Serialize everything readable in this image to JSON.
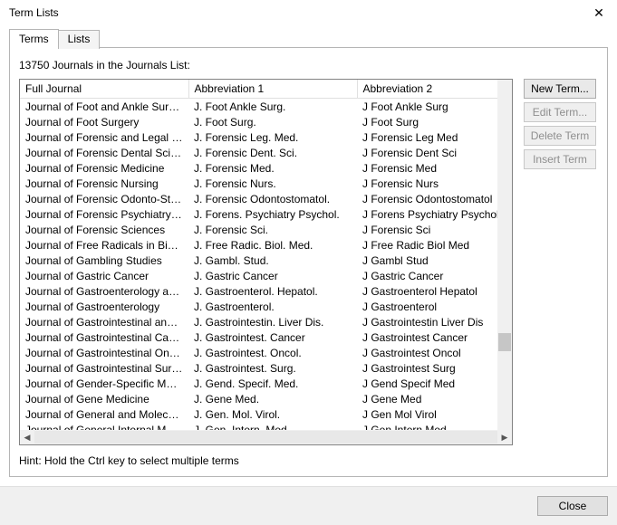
{
  "window": {
    "title": "Term Lists",
    "close_label": "✕"
  },
  "tabs": {
    "terms": "Terms",
    "lists": "Lists"
  },
  "count_text": "13750 Journals in the Journals List:",
  "columns": {
    "full": "Full Journal",
    "a1": "Abbreviation 1",
    "a2": "Abbreviation 2"
  },
  "rows": [
    {
      "full": "Journal of Foot and Ankle Surgery",
      "a1": "J. Foot Ankle Surg.",
      "a2": "J Foot Ankle Surg"
    },
    {
      "full": "Journal of Foot Surgery",
      "a1": "J. Foot Surg.",
      "a2": "J Foot Surg"
    },
    {
      "full": "Journal of Forensic and Legal Me...",
      "a1": "J. Forensic Leg. Med.",
      "a2": "J Forensic Leg Med"
    },
    {
      "full": "Journal of Forensic Dental Sciences",
      "a1": "J. Forensic Dent. Sci.",
      "a2": "J Forensic Dent Sci"
    },
    {
      "full": "Journal of Forensic Medicine",
      "a1": "J. Forensic Med.",
      "a2": "J Forensic Med"
    },
    {
      "full": "Journal of Forensic Nursing",
      "a1": "J. Forensic Nurs.",
      "a2": "J Forensic Nurs"
    },
    {
      "full": "Journal of Forensic Odonto-Stom...",
      "a1": "J. Forensic Odontostomatol.",
      "a2": "J Forensic Odontostomatol"
    },
    {
      "full": "Journal of Forensic Psychiatry & ...",
      "a1": "J. Forens. Psychiatry Psychol.",
      "a2": "J Forens Psychiatry Psychol"
    },
    {
      "full": "Journal of Forensic Sciences",
      "a1": "J. Forensic Sci.",
      "a2": "J Forensic Sci"
    },
    {
      "full": "Journal of Free Radicals in Biolog...",
      "a1": "J. Free Radic. Biol. Med.",
      "a2": "J Free Radic Biol Med"
    },
    {
      "full": "Journal of Gambling Studies",
      "a1": "J. Gambl. Stud.",
      "a2": "J Gambl Stud"
    },
    {
      "full": "Journal of Gastric Cancer",
      "a1": "J. Gastric Cancer",
      "a2": "J Gastric Cancer"
    },
    {
      "full": "Journal of Gastroenterology and ...",
      "a1": "J. Gastroenterol. Hepatol.",
      "a2": "J Gastroenterol Hepatol"
    },
    {
      "full": "Journal of Gastroenterology",
      "a1": "J. Gastroenterol.",
      "a2": "J Gastroenterol"
    },
    {
      "full": "Journal of Gastrointestinal and Li...",
      "a1": "J. Gastrointestin. Liver Dis.",
      "a2": "J Gastrointestin Liver Dis"
    },
    {
      "full": "Journal of Gastrointestinal Cancer",
      "a1": "J. Gastrointest. Cancer",
      "a2": "J Gastrointest Cancer"
    },
    {
      "full": "Journal of Gastrointestinal Oncol...",
      "a1": "J. Gastrointest. Oncol.",
      "a2": "J Gastrointest Oncol"
    },
    {
      "full": "Journal of Gastrointestinal Surgery",
      "a1": "J. Gastrointest. Surg.",
      "a2": "J Gastrointest Surg"
    },
    {
      "full": "Journal of Gender-Specific Medicine",
      "a1": "J. Gend. Specif. Med.",
      "a2": "J Gend Specif Med"
    },
    {
      "full": "Journal of Gene Medicine",
      "a1": "J. Gene Med.",
      "a2": "J Gene Med"
    },
    {
      "full": "Journal of General and Molecular ...",
      "a1": "J. Gen. Mol. Virol.",
      "a2": "J Gen Mol Virol"
    },
    {
      "full": "Journal of General Internal Medic...",
      "a1": "J. Gen. Intern. Med.",
      "a2": "J Gen Intern Med"
    }
  ],
  "buttons": {
    "new": "New Term...",
    "edit": "Edit Term...",
    "delete": "Delete Term",
    "insert": "Insert Term"
  },
  "hint": "Hint: Hold the Ctrl key to select multiple terms",
  "footer": {
    "close": "Close"
  }
}
